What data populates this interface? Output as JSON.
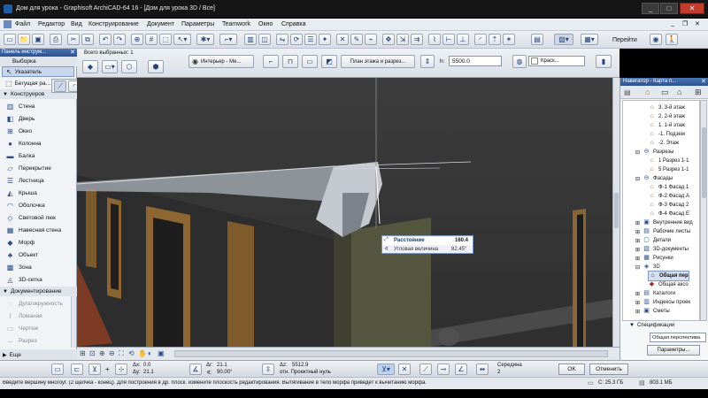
{
  "window": {
    "title": "Дом для урока - Graphisoft ArchiCAD-64 16 - [Дом для урока 3D / Все]"
  },
  "menu": [
    "Файл",
    "Редактор",
    "Вид",
    "Конструирование",
    "Документ",
    "Параметры",
    "Teamwork",
    "Окно",
    "Справка"
  ],
  "toolbar": {
    "goto_label": "Перейти"
  },
  "infobox": {
    "selected": "Всего выбранных: 1",
    "layer_label": "Интерьер - Ме...",
    "plan_section_button": "План этажа и разрез...",
    "height_label": "h:",
    "height_value": "5500.0",
    "material_label": "Краск..."
  },
  "toolbox": {
    "title": "Панель инструм...",
    "select_group": "Выборка",
    "pointer": "Указатель",
    "marquee": "Бегущая ра...",
    "design_group": "Конструиров",
    "tools": [
      "Стена",
      "Дверь",
      "Окно",
      "Колонна",
      "Балка",
      "Перекрытие",
      "Лестница",
      "Крыша",
      "Оболочка",
      "Световой люк",
      "Навесная стена",
      "Морф",
      "Объект",
      "Зона",
      "3D-сетка"
    ],
    "doc_group": "Документирование",
    "doc_tools": [
      "Дуга/окружность",
      "Ломаная",
      "Чертеж",
      "Разрез"
    ],
    "more": "Еще"
  },
  "tracker": {
    "distance_label": "Расстояние",
    "distance_value": "160.4",
    "angle_label": "Угловая величина",
    "angle_value": "82.45°"
  },
  "navigator": {
    "title": "Навигатор - Карта п...",
    "items": [
      "3. 3-й этаж",
      "2. 2-й этаж",
      "1. 1-й этаж",
      "-1. Подзем",
      "-2. Этаж",
      "Разрезы",
      "1 Разрез 1-1",
      "5 Разрез 1-1",
      "Фасады",
      "Ф-1 Фасад 1",
      "Ф-2 Фасад А",
      "Ф-3 Фасад 2",
      "Ф-4 Фасад Е",
      "Внутренние вид",
      "Рабочие листы",
      "Детали",
      "3D-документы",
      "Рисунки",
      "3D",
      "Общая пер",
      "Общая аксо",
      "Каталоги",
      "Индексы проек",
      "Сметы"
    ],
    "specs_label": "Спецификации",
    "view_value": "Общая перспектива",
    "params_button": "Параметры..."
  },
  "bottom": {
    "dx_label": "Δx:",
    "dx_value": "0.0",
    "dy_label": "Δy:",
    "dy_value": "21.1",
    "dr_label": "Δr:",
    "dr_value": "21.1",
    "angle_value": "90.00°",
    "dz_label": "Δz:",
    "dz_value": "5512.9",
    "ref_label": "отн. Проектный нуль",
    "middle_label": "Середина",
    "middle_value": "2",
    "ok_button": "OK",
    "cancel_button": "Отменить"
  },
  "status": {
    "hint": "Введите вершину многоуг. (2 щелчка - конец). Для построения в др. плоск. измените плоскость редактирования. Вытягивание в тело морфа приведет к вычитанию морфа.",
    "disk": "C: 25.3 ГБ",
    "memory": "803.1 МБ"
  },
  "colors": {
    "titlebar": "#1b1b1b",
    "chrome": "#d6dbe4",
    "viewport_top": "#3b3b3b",
    "accent": "#2a4d8c"
  }
}
